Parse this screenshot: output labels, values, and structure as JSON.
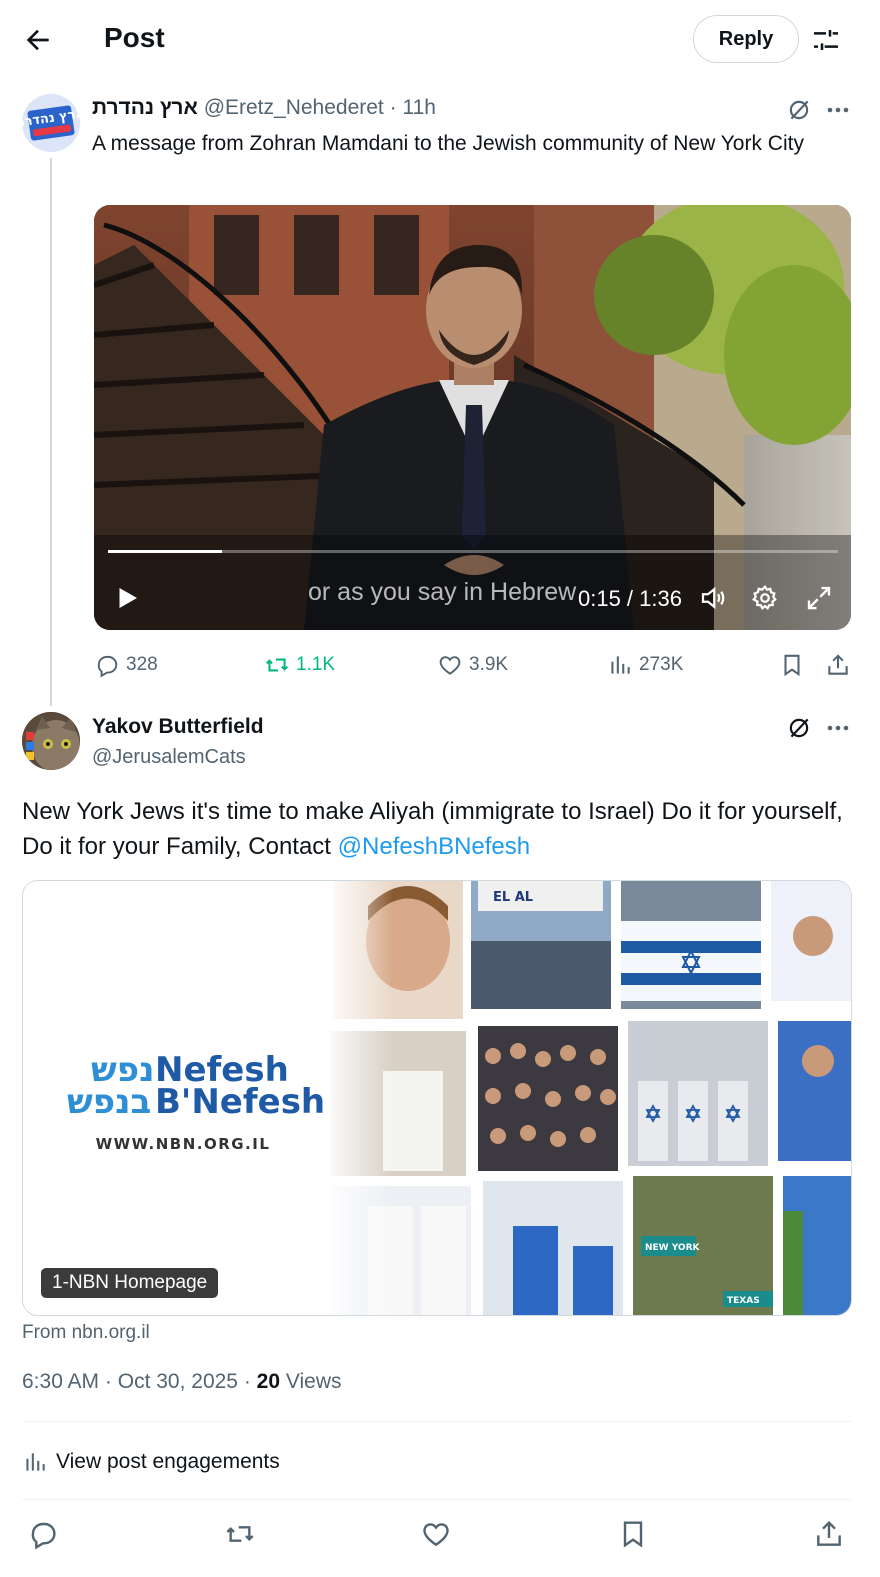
{
  "header": {
    "title": "Post",
    "reply_label": "Reply"
  },
  "tweet1": {
    "display_name": "ארץ נהדרת",
    "handle": "@Eretz_Nehederet",
    "separator": "·",
    "time": "11h",
    "avatar_text": "ארץ נהדרת",
    "text": "A message from Zohran Mamdani to the Jewish community of New York City",
    "video": {
      "caption": "or as you say in Hebrew",
      "time": "0:15 / 1:36",
      "progress": 0.156
    },
    "stats": {
      "replies": "328",
      "reposts": "1.1K",
      "likes": "3.9K",
      "views": "273K"
    }
  },
  "tweet2": {
    "display_name": "Yakov Butterfield",
    "handle": "@JerusalemCats",
    "text": "New York Jews it's time to make Aliyah (immigrate to Israel) Do it for yourself, Do it for your Family, Contact ",
    "mention": "@NefeshBNefesh",
    "card": {
      "logo_hebrew_1": "נפש",
      "logo_hebrew_2": "בנפש",
      "logo_english_1": "Nefesh",
      "logo_english_2": "B'Nefesh",
      "url_text": "WWW.NBN.ORG.IL",
      "badge": "1-NBN Homepage",
      "photo_sign_1": "NEW YORK",
      "photo_sign_2": "TEXAS",
      "photo_plane": "EL AL"
    },
    "from": "From nbn.org.il",
    "time": "6:30 AM",
    "date": "Oct 30, 2025",
    "views_count": "20",
    "views_label": "Views",
    "engagements_label": "View post engagements"
  },
  "colors": {
    "text": "#0f1419",
    "secondary": "#536471",
    "accent": "#1d9bf0",
    "repost_green": "#00ba7c",
    "border": "#cfd9de",
    "nbn_blue": "#1f5aa6"
  },
  "icons": [
    "back-arrow-icon",
    "filter-sliders-icon",
    "grok-icon",
    "more-icon",
    "play-icon",
    "volume-icon",
    "settings-gear-icon",
    "fullscreen-icon",
    "reply-icon",
    "repost-icon",
    "like-icon",
    "views-icon",
    "bookmark-icon",
    "share-icon"
  ]
}
